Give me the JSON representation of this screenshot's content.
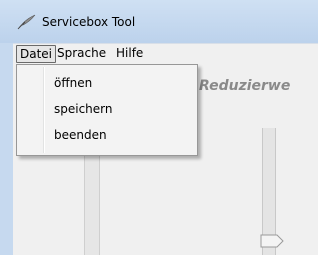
{
  "window": {
    "title": "Servicebox Tool",
    "app_icon": "quill-icon"
  },
  "menubar": {
    "items": [
      {
        "label": "Datei"
      },
      {
        "label": "Sprache"
      },
      {
        "label": "Hilfe"
      }
    ]
  },
  "dropdown": {
    "items": [
      {
        "label": "öffnen"
      },
      {
        "label": "speichern"
      },
      {
        "label": "beenden"
      }
    ]
  },
  "main": {
    "heading": "Reduzierwe"
  },
  "colors": {
    "titlebar": "#c6d9ef",
    "menubar": "#f0f0f0",
    "heading": "#8a8a8a"
  }
}
